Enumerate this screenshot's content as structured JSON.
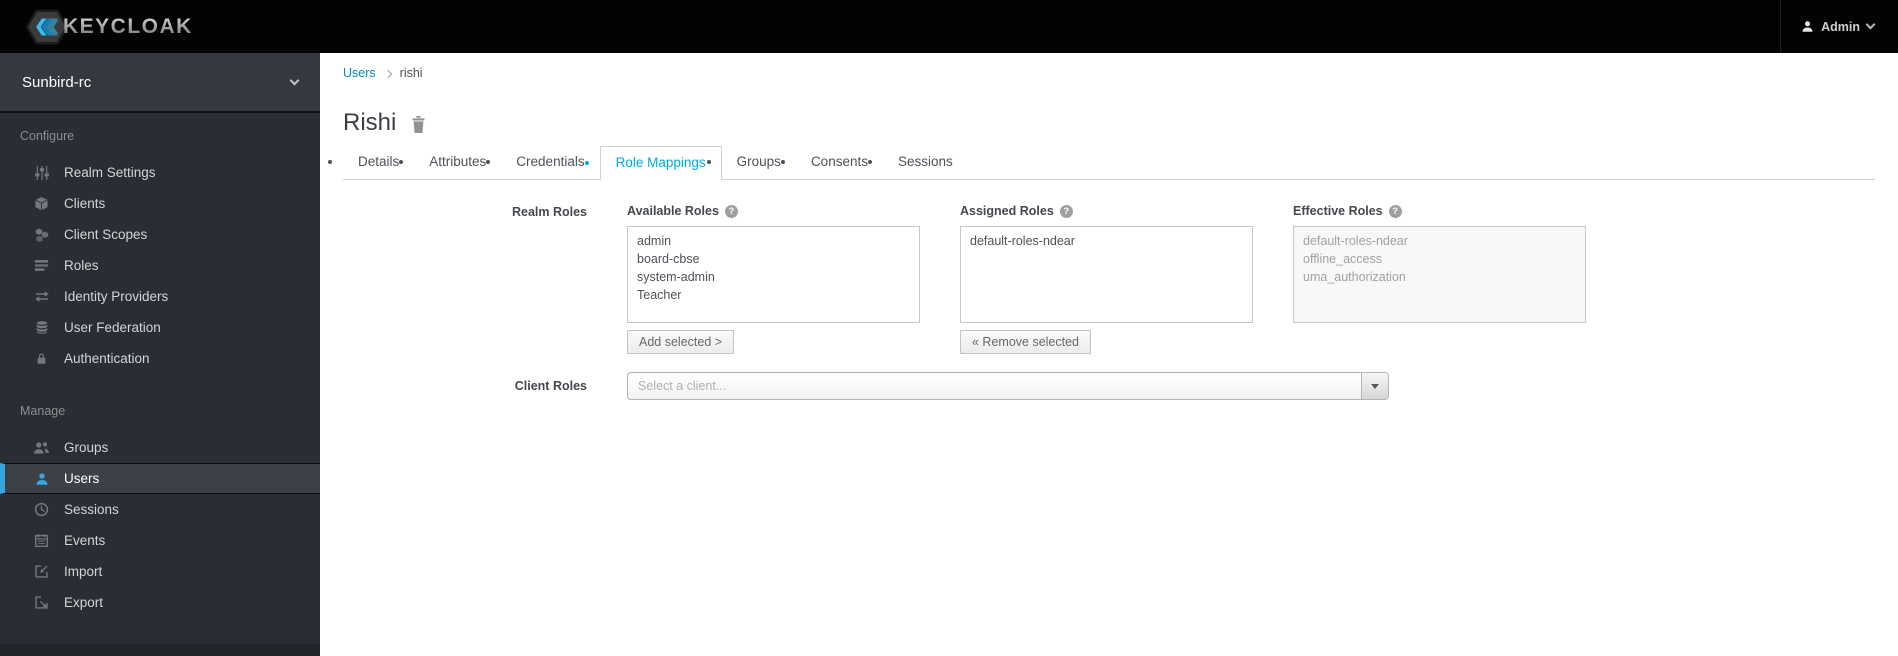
{
  "header": {
    "brand": "KEYCLOAK",
    "user_menu": {
      "label": "Admin"
    }
  },
  "sidebar": {
    "realm_selector": {
      "label": "Sunbird-rc"
    },
    "sections": [
      {
        "title": "Configure",
        "items": [
          {
            "label": "Realm Settings",
            "icon": "sliders"
          },
          {
            "label": "Clients",
            "icon": "cube"
          },
          {
            "label": "Client Scopes",
            "icon": "cubes"
          },
          {
            "label": "Roles",
            "icon": "list"
          },
          {
            "label": "Identity Providers",
            "icon": "exchange"
          },
          {
            "label": "User Federation",
            "icon": "database"
          },
          {
            "label": "Authentication",
            "icon": "lock"
          }
        ]
      },
      {
        "title": "Manage",
        "items": [
          {
            "label": "Groups",
            "icon": "users"
          },
          {
            "label": "Users",
            "icon": "user",
            "active": true
          },
          {
            "label": "Sessions",
            "icon": "clock"
          },
          {
            "label": "Events",
            "icon": "calendar"
          },
          {
            "label": "Import",
            "icon": "import"
          },
          {
            "label": "Export",
            "icon": "export"
          }
        ]
      }
    ]
  },
  "breadcrumb": {
    "link": "Users",
    "current": "rishi"
  },
  "page": {
    "title": "Rishi"
  },
  "tabs": [
    {
      "label": "Details"
    },
    {
      "label": "Attributes"
    },
    {
      "label": "Credentials"
    },
    {
      "label": "Role Mappings",
      "active": true
    },
    {
      "label": "Groups"
    },
    {
      "label": "Consents"
    },
    {
      "label": "Sessions"
    }
  ],
  "form": {
    "realm_roles": {
      "label": "Realm Roles",
      "available": {
        "label": "Available Roles",
        "items": [
          "admin",
          "board-cbse",
          "system-admin",
          "Teacher"
        ],
        "button": "Add selected >"
      },
      "assigned": {
        "label": "Assigned Roles",
        "items": [
          "default-roles-ndear"
        ],
        "button": "« Remove selected"
      },
      "effective": {
        "label": "Effective Roles",
        "items": [
          "default-roles-ndear",
          "offline_access",
          "uma_authorization"
        ]
      }
    },
    "client_roles": {
      "label": "Client Roles",
      "placeholder": "Select a client..."
    }
  },
  "colors": {
    "topbar_background": "#030303",
    "sidebar_background": "#292e34",
    "sidebar_active_accent": "#39a5dc",
    "active_tab_text": "#00a9e0",
    "breadcrumb_link": "#0088ce"
  }
}
